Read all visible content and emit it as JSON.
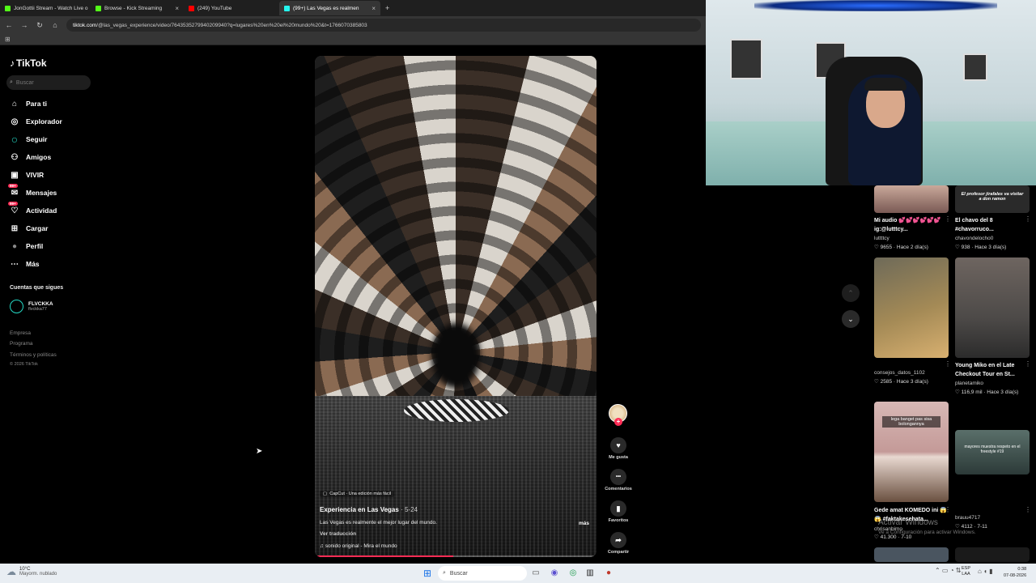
{
  "browser": {
    "tabs": [
      {
        "label": "JonGottii Stream - Watch Live o",
        "color": "#53fc18"
      },
      {
        "label": "Browse - Kick Streaming",
        "color": "#53fc18"
      },
      {
        "label": "(249) YouTube",
        "color": "#ff0000"
      },
      {
        "label": "(99+) Las Vegas es realmen",
        "color": "#25f4ee"
      }
    ],
    "url_domain": "tiktok.com",
    "url_path": "/@las_vegas_experience/video/7643535279940209940?q=lugares%20en%20el%20mundo%20&t=1766070385803"
  },
  "sidebar": {
    "logo": "TikTok",
    "search_placeholder": "Buscar",
    "items": [
      {
        "label": "Para ti",
        "icon": "home-icon",
        "glyph": "⌂"
      },
      {
        "label": "Explorador",
        "icon": "compass-icon",
        "glyph": "◎"
      },
      {
        "label": "Seguir",
        "icon": "following-icon",
        "glyph": "○"
      },
      {
        "label": "Amigos",
        "icon": "friends-icon",
        "glyph": "⚇"
      },
      {
        "label": "VIVIR",
        "icon": "live-icon",
        "glyph": "▣"
      },
      {
        "label": "Mensajes",
        "icon": "messages-icon",
        "glyph": "✉",
        "badge": "99+"
      },
      {
        "label": "Actividad",
        "icon": "activity-icon",
        "glyph": "♡",
        "badge": "99+"
      },
      {
        "label": "Cargar",
        "icon": "upload-icon",
        "glyph": "⊞"
      },
      {
        "label": "Perfil",
        "icon": "profile-icon",
        "glyph": "●"
      },
      {
        "label": "Más",
        "icon": "more-icon",
        "glyph": "⋯"
      }
    ],
    "following_title": "Cuentas que sigues",
    "following": [
      {
        "name": "FLVCKKA",
        "handle": "flvckka77"
      }
    ],
    "footer": [
      "Empresa",
      "Programa",
      "Términos y políticas",
      "© 2026 TikTok"
    ]
  },
  "video": {
    "capcut": "CapCut · Una edición más fácil",
    "title": "Experiencia en Las Vegas",
    "date": "· 5-24",
    "description": "Las Vegas es realmente el mejor lugar del mundo.",
    "more": "más",
    "translate": "Ver traducción",
    "sound": "sonido original - Mira el mundo",
    "progress": 0.49
  },
  "actions": [
    {
      "label": "Me gusta",
      "icon": "heart-icon",
      "glyph": "♥"
    },
    {
      "label": "Comentarios",
      "icon": "comment-icon",
      "glyph": "•••"
    },
    {
      "label": "Favoritos",
      "icon": "bookmark-icon",
      "glyph": "▮"
    },
    {
      "label": "Compartir",
      "icon": "share-icon",
      "glyph": "➦"
    }
  ],
  "feed": [
    {
      "title": "Mi audio 💕💕💕💕💕💕 ig:@lutttcy...",
      "author": "luttttcy",
      "stats": "♡ 9655 · Hace 2 día(s)"
    },
    {
      "title": "El chavo del 8 #chavorruco...",
      "author": "chavondelocho0",
      "stats": "♡ 938 · Hace 3 día(s)",
      "overlay": "El profesor jirafales va visitar a don ramon"
    },
    {
      "author": "consejos_datos_1102",
      "stats": "♡ 2585 · Hace 3 día(s)"
    },
    {
      "title": "Young Miko en el Late Checkout Tour en St...",
      "author": "planetamiko",
      "stats": "♡ 116,9 mil · Hace 3 día(s)"
    },
    {
      "title": "Gede amat KOMEDO ini 😱😱 #faktakesehata...",
      "author": "chrisanbimo",
      "stats": "♡ 41.300 · 7-10",
      "overlay": "lega banget pas sisa bolongannya"
    },
    {
      "author": "brauu4717",
      "stats": "♡ 4112 · 7-11",
      "overlay": "mayores muestra respeto en el freestyle #19"
    }
  ],
  "windows_watermark": {
    "line1": "Activar Windows",
    "line2": "Ve a Configuración para activar Windows."
  },
  "taskbar": {
    "temp": "10°C",
    "weather": "Mayorm. nublado",
    "search": "Buscar",
    "lang1": "ESP",
    "lang2": "LAA",
    "time": "0:38",
    "date": "07-08-2026"
  }
}
